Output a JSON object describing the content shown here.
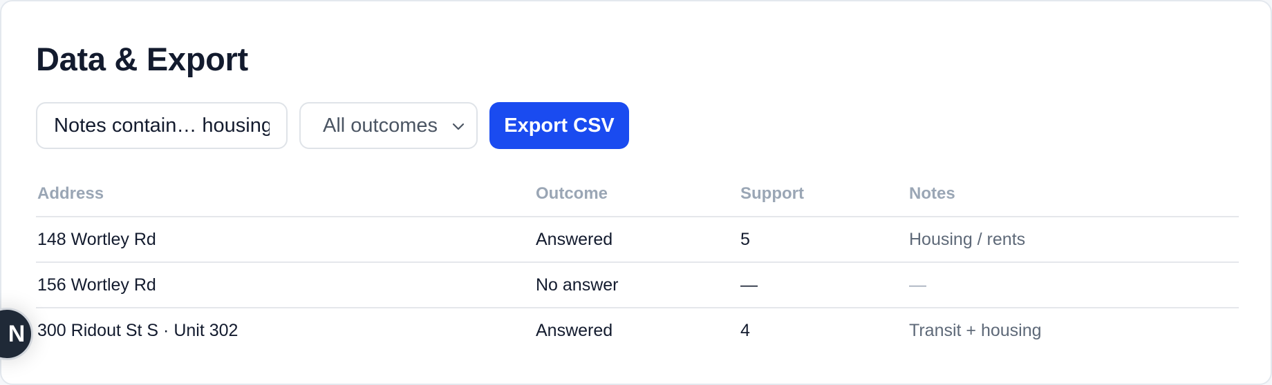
{
  "page": {
    "title": "Data & Export"
  },
  "filters": {
    "search_value": "Notes contain… housing",
    "outcome_selected": "All outcomes",
    "outcome_chevron_icon": "chevron-down-icon",
    "export_label": "Export CSV",
    "accent_color": "#1a4bf0"
  },
  "table": {
    "columns": [
      "Address",
      "Outcome",
      "Support",
      "Notes"
    ],
    "rows": [
      {
        "address": "148 Wortley Rd",
        "outcome": "Answered",
        "support": "5",
        "notes": "Housing / rents"
      },
      {
        "address": "156 Wortley Rd",
        "outcome": "No answer",
        "support": "—",
        "notes": "—"
      },
      {
        "address": "300 Ridout St S · Unit 302",
        "outcome": "Answered",
        "support": "4",
        "notes": "Transit + housing"
      }
    ]
  },
  "overlay": {
    "avatar_letter": "N"
  }
}
